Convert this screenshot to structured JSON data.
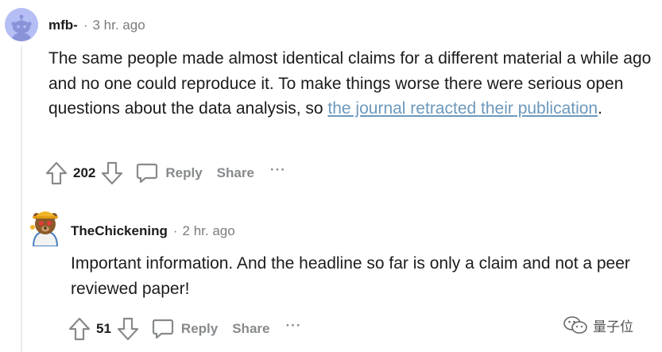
{
  "comments": [
    {
      "username": "mfb-",
      "separator": "·",
      "time": "3 hr. ago",
      "text_before": "The same people made almost identical claims for a different material a while ago and no one could reproduce it. To make things worse there were serious open questions about the data analysis, so ",
      "link_text": "the journal retracted their publication",
      "text_after": ".",
      "score": "202",
      "reply_label": "Reply",
      "share_label": "Share",
      "more_label": "···"
    },
    {
      "username": "TheChickening",
      "separator": "·",
      "time": "2 hr. ago",
      "text": "Important information. And the headline so far is only a claim and not a peer reviewed paper!",
      "score": "51",
      "reply_label": "Reply",
      "share_label": "Share",
      "more_label": "···"
    }
  ],
  "watermark": {
    "text": "量子位"
  },
  "colors": {
    "link": "#6c98bd",
    "muted": "#878a8c",
    "avatar_bg": "#b5bef5"
  }
}
